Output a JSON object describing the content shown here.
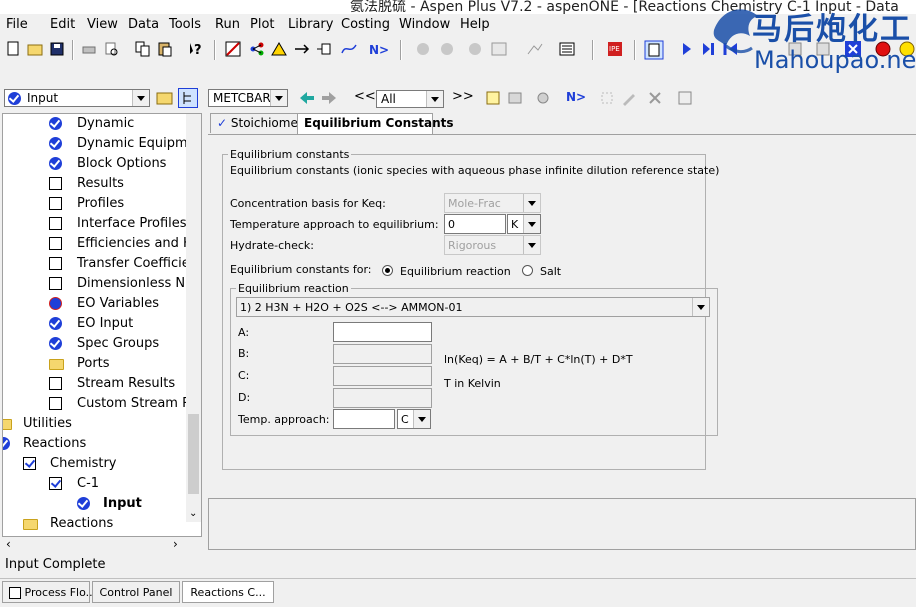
{
  "window": {
    "title": "氨法脱硫 - Aspen Plus V7.2 - aspenONE - [Reactions Chemistry C-1 Input - Data"
  },
  "watermark": {
    "chinese": "马后炮化工",
    "latin": "Mahoupao.net"
  },
  "menu": [
    "File",
    "Edit",
    "View",
    "Data",
    "Tools",
    "Run",
    "Plot",
    "Library",
    "Costing",
    "Window",
    "Help"
  ],
  "navigator": {
    "combo_value": "Input",
    "tree": [
      {
        "label": "Dynamic",
        "icon": "check"
      },
      {
        "label": "Dynamic Equipmen",
        "icon": "check"
      },
      {
        "label": "Block Options",
        "icon": "check"
      },
      {
        "label": "Results",
        "icon": "empty"
      },
      {
        "label": "Profiles",
        "icon": "empty"
      },
      {
        "label": "Interface Profiles",
        "icon": "empty"
      },
      {
        "label": "Efficiencies and HE",
        "icon": "empty"
      },
      {
        "label": "Transfer Coefficien",
        "icon": "empty"
      },
      {
        "label": "Dimensionless Nur",
        "icon": "empty"
      },
      {
        "label": "EO Variables",
        "icon": "eo"
      },
      {
        "label": "EO Input",
        "icon": "check"
      },
      {
        "label": "Spec Groups",
        "icon": "check"
      },
      {
        "label": "Ports",
        "icon": "folder"
      },
      {
        "label": "Stream Results",
        "icon": "empty"
      },
      {
        "label": "Custom Stream Re",
        "icon": "empty"
      },
      {
        "label": "Utilities",
        "icon": "folder"
      },
      {
        "label": "Reactions",
        "icon": "check"
      },
      {
        "label": "Chemistry",
        "icon": "checkbox"
      },
      {
        "label": "C-1",
        "icon": "checkbox"
      },
      {
        "label": "Input",
        "icon": "check"
      },
      {
        "label": "Reactions",
        "icon": "folder"
      }
    ]
  },
  "formbar": {
    "units_value": "METCBAR",
    "filter_value": "All",
    "prev_label": "<<",
    "next_label": ">>",
    "next_icon": "N>"
  },
  "tabs": [
    {
      "label": "Stoichiometry",
      "checked": true
    },
    {
      "label": "Equilibrium Constants",
      "active": true
    }
  ],
  "form": {
    "group_title": "Equilibrium constants",
    "description": "Equilibrium constants (ionic species with aqueous phase infinite dilution reference state)",
    "conc_basis_label": "Concentration basis for Keq:",
    "conc_basis_value": "Mole-Frac",
    "temp_approach_label": "Temperature approach to equilibrium:",
    "temp_approach_value": "0",
    "temp_approach_unit": "K",
    "hydrate_label": "Hydrate-check:",
    "hydrate_value": "Rigorous",
    "constants_for_label": "Equilibrium constants for:",
    "radio_equilibrium": "Equilibrium reaction",
    "radio_salt": "Salt",
    "reaction_group_title": "Equilibrium reaction",
    "reaction_value": "1)  2 H3N  +  H2O  +  O2S <-->  AMMON-01",
    "a_label": "A:",
    "b_label": "B:",
    "c_label": "C:",
    "d_label": "D:",
    "temp_app_label": "Temp. approach:",
    "temp_app_unit": "C",
    "equation": "ln(Keq) = A + B/T + C*ln(T) + D*T",
    "kelvin_note": "T in Kelvin"
  },
  "status": {
    "text": "Input Complete"
  },
  "taskbar": [
    "Process Flo...",
    "Control Panel",
    "Reactions C..."
  ],
  "colors": {
    "check_blue": "#1f3fd8",
    "watermark_blue": "#1a4fa8"
  }
}
